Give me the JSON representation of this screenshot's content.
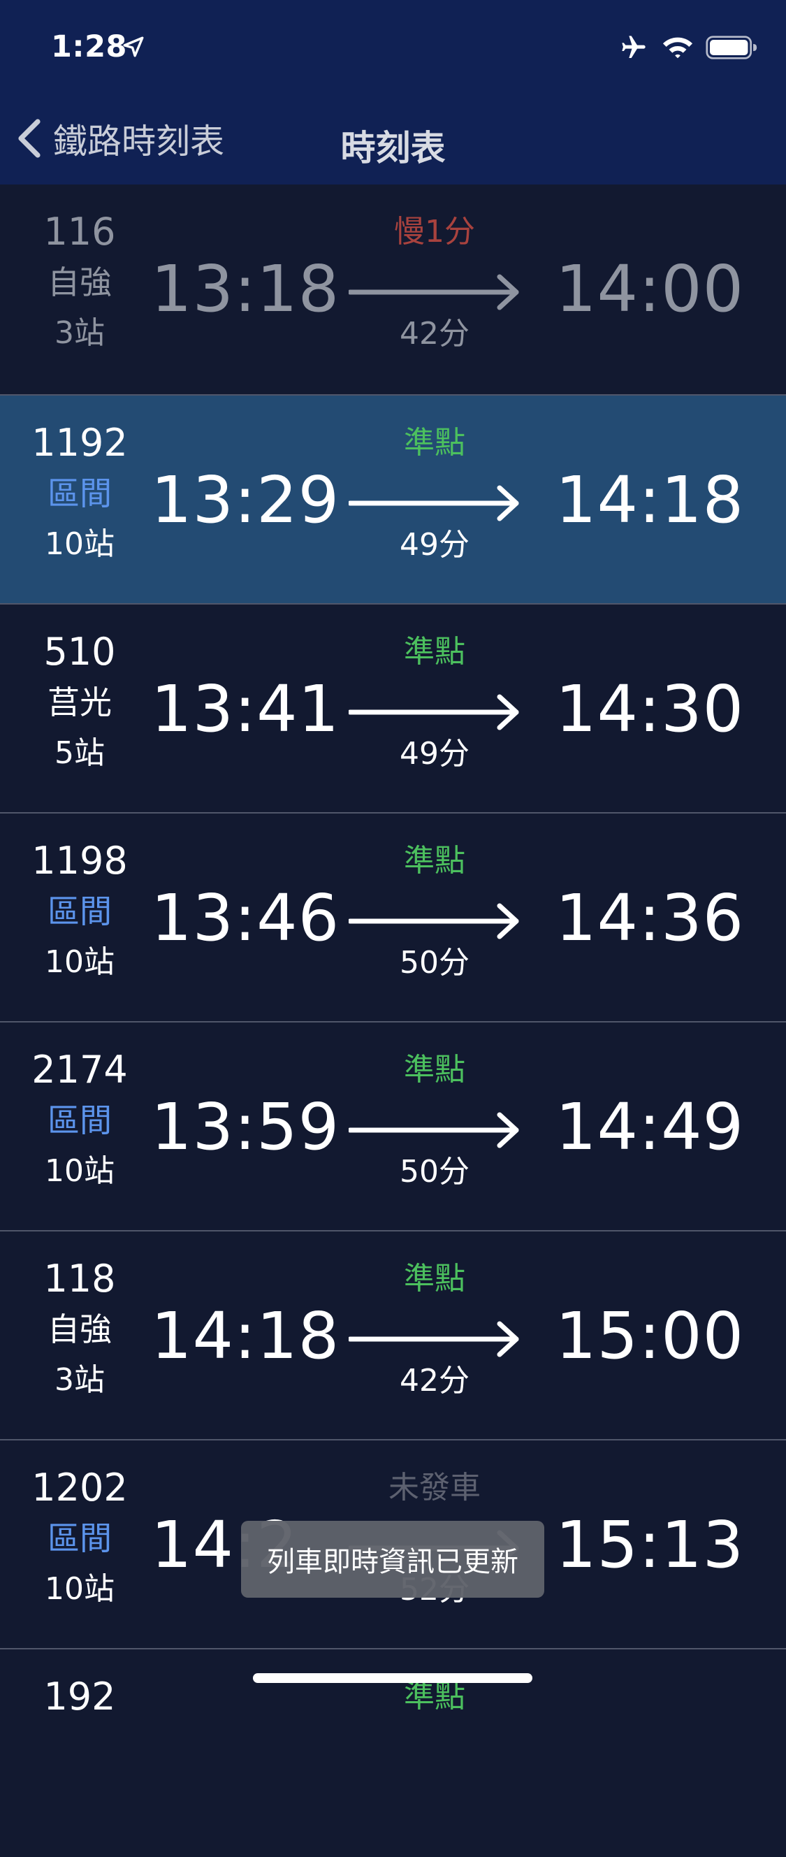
{
  "colors": {
    "header_bg": "#102154",
    "row_bg": "#121930",
    "highlight_bg": "#234b73",
    "on_time": "#4cc05e",
    "delay": "#a8423e",
    "not_departed": "#5d6170",
    "qujian": "#5c94ec"
  },
  "status_bar": {
    "time": "1:28",
    "icons": [
      "location-arrow-icon",
      "airplane-icon",
      "wifi-icon",
      "battery-icon"
    ]
  },
  "nav": {
    "back_label": "鐵路時刻表",
    "title": "時刻表"
  },
  "trains": [
    {
      "num": "116",
      "kind": "自強",
      "stops": "3站",
      "dep": "13:18",
      "arr": "14:00",
      "status": "慢1分",
      "duration": "42分"
    },
    {
      "num": "1192",
      "kind": "區間",
      "stops": "10站",
      "dep": "13:29",
      "arr": "14:18",
      "status": "準點",
      "duration": "49分"
    },
    {
      "num": "510",
      "kind": "莒光",
      "stops": "5站",
      "dep": "13:41",
      "arr": "14:30",
      "status": "準點",
      "duration": "49分"
    },
    {
      "num": "1198",
      "kind": "區間",
      "stops": "10站",
      "dep": "13:46",
      "arr": "14:36",
      "status": "準點",
      "duration": "50分"
    },
    {
      "num": "2174",
      "kind": "區間",
      "stops": "10站",
      "dep": "13:59",
      "arr": "14:49",
      "status": "準點",
      "duration": "50分"
    },
    {
      "num": "118",
      "kind": "自強",
      "stops": "3站",
      "dep": "14:18",
      "arr": "15:00",
      "status": "準點",
      "duration": "42分"
    },
    {
      "num": "1202",
      "kind": "區間",
      "stops": "10站",
      "dep": "14:2",
      "arr": "15:13",
      "status": "未發車",
      "duration": "52分"
    },
    {
      "num": "192",
      "status": "準點"
    }
  ],
  "toast": "列車即時資訊已更新"
}
